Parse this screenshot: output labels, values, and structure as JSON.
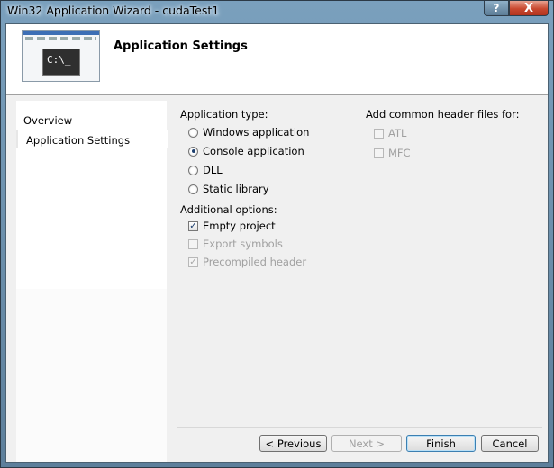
{
  "window": {
    "title": "Win32 Application Wizard - cudaTest1",
    "help_label": "?",
    "close_label": "X"
  },
  "header": {
    "title": "Application Settings",
    "icon_text": "C:\\_"
  },
  "nav": {
    "items": [
      {
        "label": "Overview"
      },
      {
        "label": "Application Settings",
        "selected": true
      }
    ]
  },
  "app_type": {
    "label": "Application type:",
    "options": [
      {
        "label": "Windows application",
        "checked": false
      },
      {
        "label": "Console application",
        "checked": true
      },
      {
        "label": "DLL",
        "checked": false
      },
      {
        "label": "Static library",
        "checked": false
      }
    ]
  },
  "additional": {
    "label": "Additional options:",
    "options": [
      {
        "label": "Empty project",
        "checked": true,
        "enabled": true
      },
      {
        "label": "Export symbols",
        "checked": false,
        "enabled": false
      },
      {
        "label": "Precompiled header",
        "checked": true,
        "enabled": false
      }
    ]
  },
  "headers": {
    "label": "Add common header files for:",
    "options": [
      {
        "label": "ATL",
        "checked": false,
        "enabled": false
      },
      {
        "label": "MFC",
        "checked": false,
        "enabled": false
      }
    ]
  },
  "buttons": {
    "previous": "< Previous",
    "next": "Next >",
    "finish": "Finish",
    "cancel": "Cancel"
  },
  "glyphs": {
    "check": "✓"
  }
}
